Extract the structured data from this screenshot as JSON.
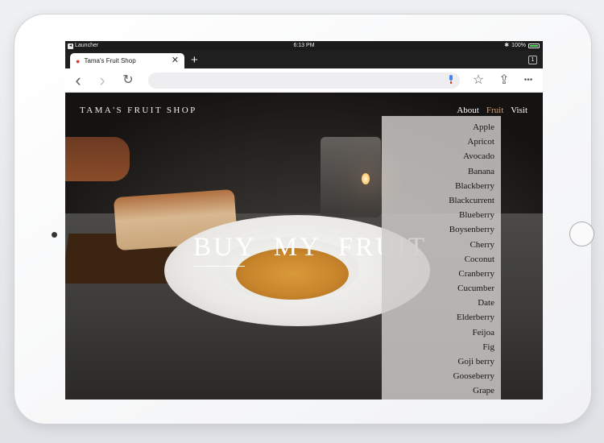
{
  "status_bar": {
    "back_app": "Launcher",
    "time": "6:13 PM",
    "bluetooth": "✱",
    "battery_percent": "100%"
  },
  "browser": {
    "tab": {
      "title": "Tama's Fruit Shop",
      "close_glyph": "✕"
    },
    "new_tab_glyph": "+",
    "tab_count": "1",
    "toolbar": {
      "back_glyph": "‹",
      "forward_glyph": "›",
      "reload_glyph": "↻",
      "bookmark_glyph": "☆",
      "share_glyph": "⇪",
      "menu_glyph": "•••",
      "address_value": ""
    }
  },
  "site": {
    "brand": "TAMA'S FRUIT SHOP",
    "nav": [
      {
        "label": "About"
      },
      {
        "label": "Fruit",
        "active": true
      },
      {
        "label": "Visit"
      }
    ],
    "hero": [
      "BUY",
      "MY",
      "FRUIT"
    ],
    "fruit_menu": [
      "Apple",
      "Apricot",
      "Avocado",
      "Banana",
      "Blackberry",
      "Blackcurrent",
      "Blueberry",
      "Boysenberry",
      "Cherry",
      "Coconut",
      "Cranberry",
      "Cucumber",
      "Date",
      "Elderberry",
      "Feijoa",
      "Fig",
      "Goji berry",
      "Gooseberry",
      "Grape"
    ]
  },
  "colors": {
    "active_nav": "#e19a64",
    "dropdown_bg": "#cdcbc8",
    "status_bar_bg": "#1b1b1b",
    "mic_blue": "#4285f4"
  },
  "icons": {
    "favicon": "tomato-icon",
    "mic": "microphone-icon"
  }
}
